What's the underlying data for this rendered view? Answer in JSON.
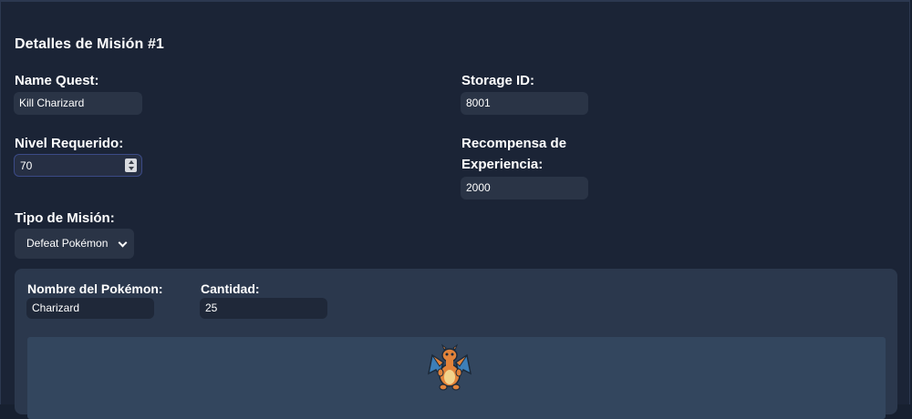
{
  "title": "Detalles de Misión #1",
  "fields": {
    "name_quest": {
      "label": "Name Quest:",
      "value": "Kill Charizard"
    },
    "storage_id": {
      "label": "Storage ID:",
      "value": "8001"
    },
    "nivel": {
      "label": "Nivel Requerido:",
      "value": "70"
    },
    "recompensa": {
      "label_line1": "Recompensa de",
      "label_line2": "Experiencia:",
      "value": "2000"
    },
    "tipo": {
      "label": "Tipo de Misión:",
      "selected": "Defeat Pokémon"
    }
  },
  "pokemon_section": {
    "nombre_label": "Nombre del Pokémon:",
    "nombre_value": "Charizard",
    "cantidad_label": "Cantidad:",
    "cantidad_value": "25",
    "sprite_icon": "charizard-sprite"
  },
  "colors": {
    "background": "#1b2436",
    "input": "#2a3446",
    "subpanel": "#2b384d",
    "imagebox": "#33465e"
  }
}
